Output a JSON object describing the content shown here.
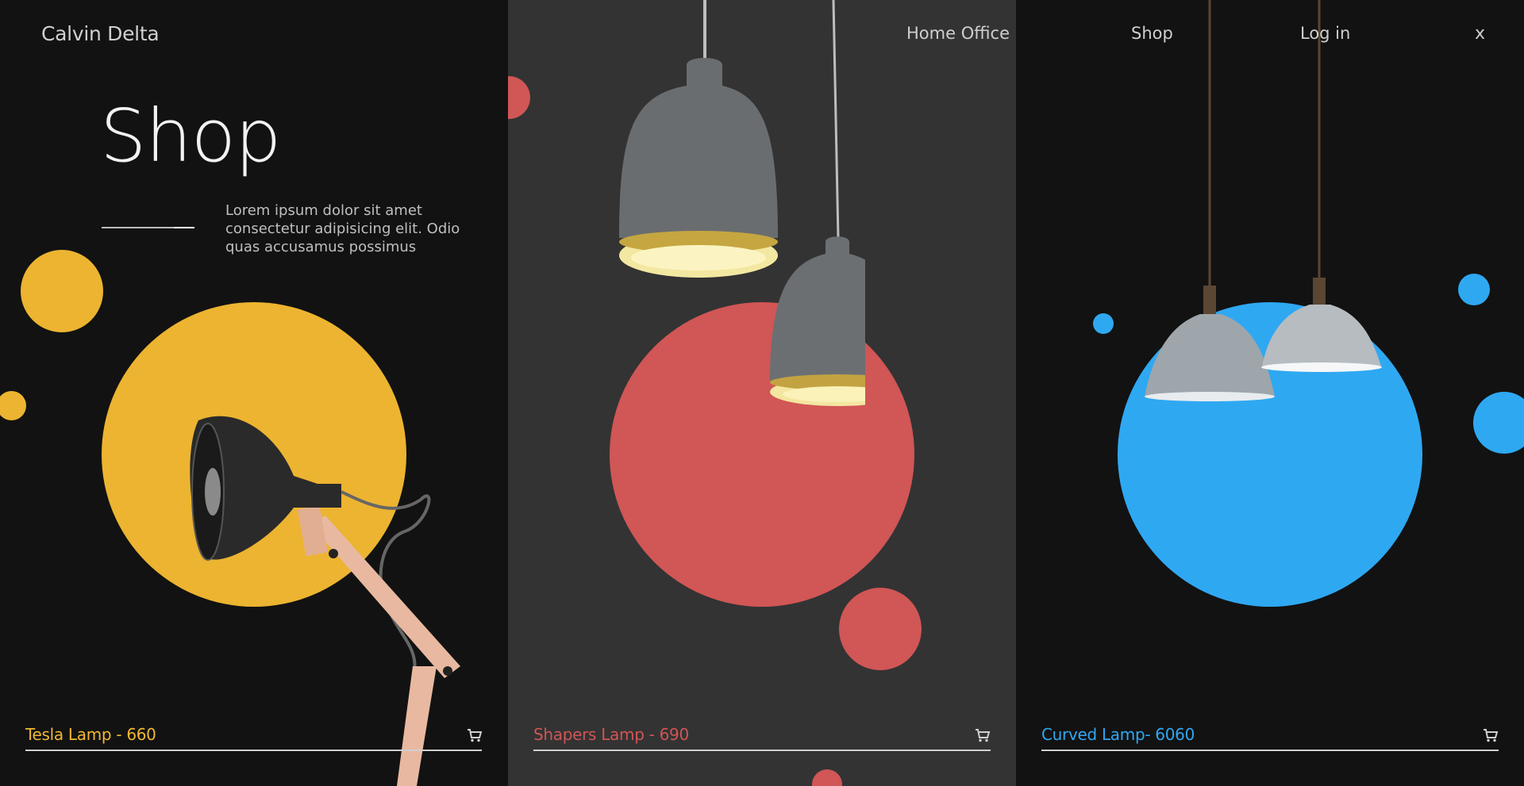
{
  "brand": "Calvin Delta",
  "hero": {
    "title": "Shop",
    "description": "Lorem ipsum dolor sit amet consectetur adipisicing elit. Odio quas accusamus possimus"
  },
  "nav": {
    "items": [
      {
        "label": "Home Office"
      },
      {
        "label": "Shop"
      },
      {
        "label": "Log in"
      }
    ],
    "close_label": "x"
  },
  "products": [
    {
      "name": "Tesla Lamp - 660",
      "color": "#f0b830"
    },
    {
      "name": "Shapers Lamp - 690",
      "color": "#d05555"
    },
    {
      "name": "Curved Lamp- 6060",
      "color": "#2fa8f2"
    }
  ],
  "colors": {
    "yellow": "#ecb430",
    "red": "#d15656",
    "blue": "#2fa8f2",
    "dark": "#121212",
    "mid": "#333333"
  },
  "icons": [
    "cart-icon",
    "close-icon",
    "menu-lines-icon"
  ]
}
